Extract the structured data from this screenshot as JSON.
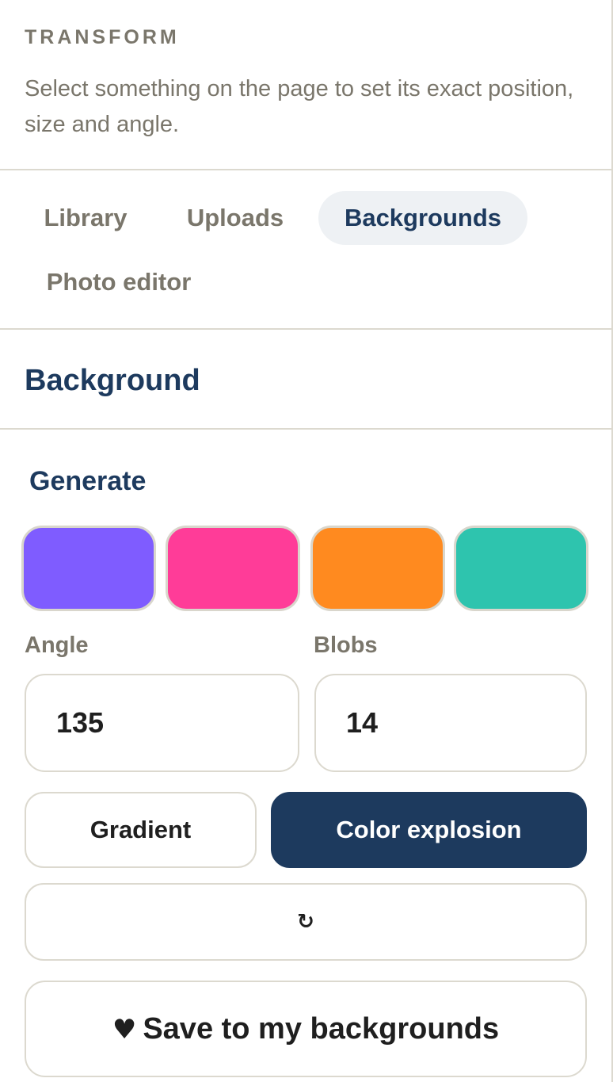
{
  "transform": {
    "title": "TRANSFORM",
    "description": "Select something on the page to set its exact position, size and angle."
  },
  "tabs": [
    {
      "label": "Library",
      "active": false
    },
    {
      "label": "Uploads",
      "active": false
    },
    {
      "label": "Backgrounds",
      "active": true
    },
    {
      "label": "Photo editor",
      "active": false
    }
  ],
  "background": {
    "title": "Background"
  },
  "generate": {
    "title": "Generate",
    "swatches": [
      "#7f5cff",
      "#ff3c98",
      "#ff8a1f",
      "#2ec4ae"
    ],
    "angle": {
      "label": "Angle",
      "value": "135"
    },
    "blobs": {
      "label": "Blobs",
      "value": "14"
    },
    "modes": {
      "gradient": "Gradient",
      "explosion": "Color explosion",
      "selected": "Color explosion"
    },
    "refresh": {
      "icon": "refresh-icon",
      "glyph": "↻"
    },
    "save": {
      "icon": "heart-icon",
      "glyph": "♥",
      "label": "Save to my backgrounds"
    }
  },
  "colors": {
    "accent": "#1d3a5e",
    "muted_text": "#7a766b",
    "border": "#dcd9cf",
    "active_tab_bg": "#eef1f4"
  }
}
